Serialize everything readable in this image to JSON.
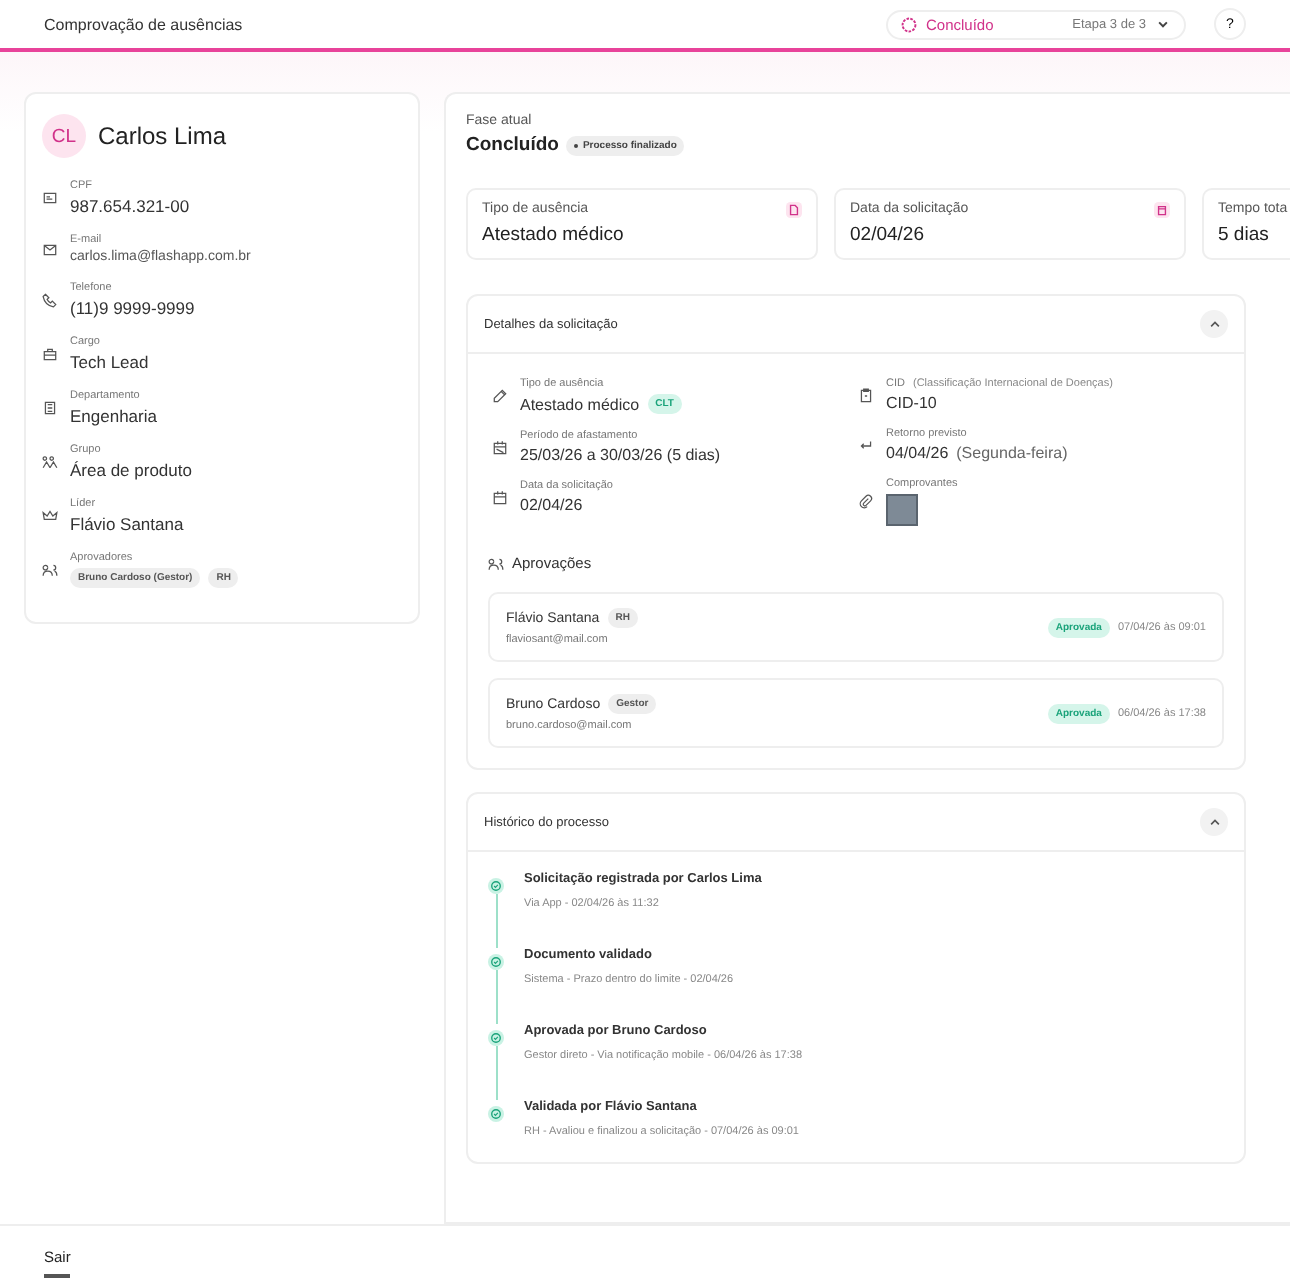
{
  "header": {
    "title": "Comprovação de ausências",
    "status": {
      "label": "Concluído",
      "step": "Etapa 3 de 3"
    },
    "help": "?"
  },
  "profile": {
    "initials": "CL",
    "name": "Carlos Lima",
    "fields": [
      {
        "kind": "text",
        "label": "CPF",
        "value": "987.654.321-00"
      },
      {
        "kind": "small",
        "label": "E-mail",
        "value": "carlos.lima@flashapp.com.br"
      },
      {
        "kind": "text",
        "label": "Telefone",
        "value": "(11)9 9999-9999"
      },
      {
        "kind": "text",
        "label": "Cargo",
        "value": "Tech Lead"
      },
      {
        "kind": "text",
        "label": "Departamento",
        "value": "Engenharia"
      },
      {
        "kind": "text",
        "label": "Grupo",
        "value": "Área de produto"
      },
      {
        "kind": "text",
        "label": "Líder",
        "value": "Flávio Santana"
      },
      {
        "kind": "chips",
        "label": "Aprovadores",
        "chips": [
          "Bruno Cardoso (Gestor)",
          "RH"
        ]
      }
    ]
  },
  "phase": {
    "label": "Fase atual",
    "value": "Concluído",
    "badge": "Processo finalizado"
  },
  "stats": [
    {
      "label": "Tipo de ausência",
      "value": "Atestado médico"
    },
    {
      "label": "Data da solicitação",
      "value": "02/04/26"
    },
    {
      "label": "Tempo tota",
      "value": "5 dias"
    }
  ],
  "details": {
    "title": "Detalhes da solicitação",
    "expanded": true,
    "left": [
      {
        "label": "Tipo de ausência",
        "value": "Atestado médico",
        "tag": "CLT"
      },
      {
        "label": "Período de afastamento",
        "value": "25/03/26 a 30/03/26 (5 dias)"
      },
      {
        "label": "Data da solicitação",
        "value": "02/04/26"
      }
    ],
    "right": [
      {
        "label": "CID",
        "note": "(Classificação Internacional de Doenças)",
        "value": "CID-10"
      },
      {
        "label": "Retorno previsto",
        "value": "04/04/26",
        "note2": "(Segunda-feira)"
      }
    ],
    "attachments_label": "Comprovantes",
    "approvals_title": "Aprovações",
    "approvals": [
      {
        "name": "Flávio Santana",
        "role": "RH",
        "email": "flaviosant@mail.com",
        "status": "Aprovada",
        "time": "07/04/26 às 09:01"
      },
      {
        "name": "Bruno Cardoso",
        "role": "Gestor",
        "email": "bruno.cardoso@mail.com",
        "status": "Aprovada",
        "time": "06/04/26 às 17:38"
      }
    ]
  },
  "history": {
    "title": "Histórico do processo",
    "expanded": true,
    "events": [
      {
        "title": "Solicitação registrada por Carlos Lima",
        "subtitle": "Via App - 02/04/26 às 11:32",
        "done": true
      },
      {
        "title": "Documento validado",
        "subtitle": "Sistema - Prazo dentro do limite - 02/04/26",
        "done": true
      },
      {
        "title": "Aprovada por Bruno Cardoso",
        "subtitle": "Gestor direto - Via notificação mobile - 06/04/26 às 17:38",
        "done": true
      },
      {
        "title": "Validada por Flávio Santana",
        "subtitle": "RH - Avaliou e finalizou a solicitação - 07/04/26 às 09:01",
        "done": true
      }
    ]
  },
  "footer": {
    "tabs": [
      {
        "label": "Sair",
        "selected": true
      }
    ]
  }
}
